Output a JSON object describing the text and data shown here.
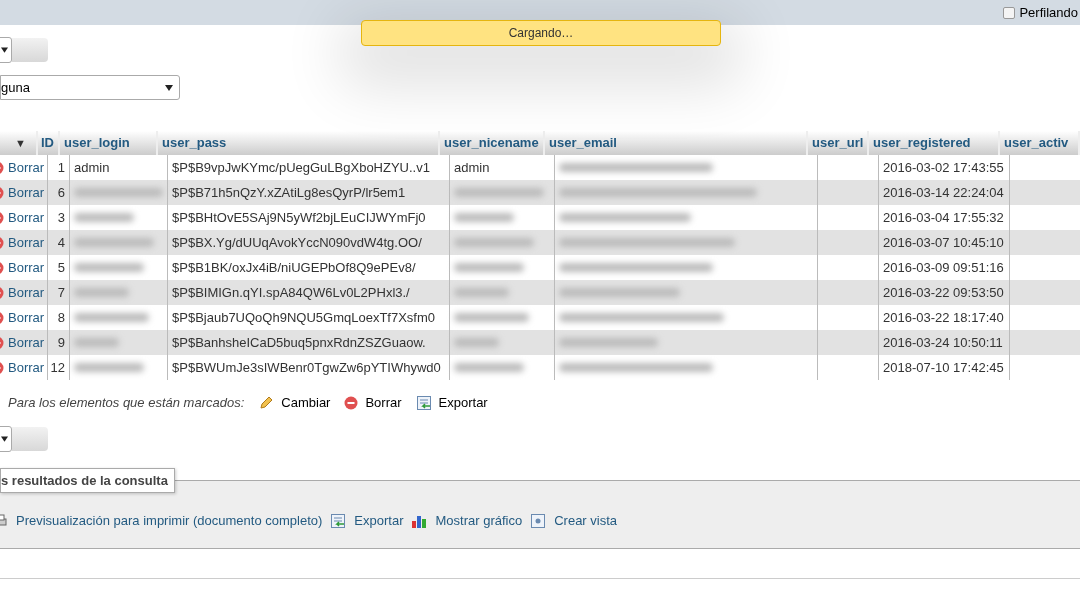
{
  "top_bar": {
    "profiling": {
      "label": "Perfilando",
      "checked": false
    }
  },
  "loading_toast": {
    "text": "Cargando…"
  },
  "filter_select": {
    "value": "guna"
  },
  "table": {
    "columns": [
      "ID",
      "user_login",
      "user_pass",
      "user_nicename",
      "user_email",
      "user_url",
      "user_registered",
      "user_activ"
    ],
    "sort_arrow": "▼",
    "rows": [
      {
        "action": "Borrar",
        "id": "1",
        "user_login": "admin",
        "user_pass": "$P$B9vpJwKYmc/pUegGuLBgXboHZYU..v1",
        "user_nicename": "admin",
        "user_registered": "2016-03-02 17:43:55"
      },
      {
        "action": "Borrar",
        "id": "6",
        "user_pass": "$P$B71h5nQzY.xZAtiLg8esQyrP/lr5em1",
        "user_registered": "2016-03-14 22:24:04"
      },
      {
        "action": "Borrar",
        "id": "3",
        "user_pass": "$P$BHtOvE5SAj9N5yWf2bjLEuCIJWYmFj0",
        "user_registered": "2016-03-04 17:55:32"
      },
      {
        "action": "Borrar",
        "id": "4",
        "user_pass": "$P$BX.Yg/dUUqAvokYccN090vdW4tg.OO/",
        "user_registered": "2016-03-07 10:45:10"
      },
      {
        "action": "Borrar",
        "id": "5",
        "user_pass": "$P$B1BK/oxJx4iB/niUGEPbOf8Q9ePEv8/",
        "user_registered": "2016-03-09 09:51:16"
      },
      {
        "action": "Borrar",
        "id": "7",
        "user_pass": "$P$BIMIGn.qYI.spA84QW6Lv0L2PHxl3./",
        "user_registered": "2016-03-22 09:53:50"
      },
      {
        "action": "Borrar",
        "id": "8",
        "user_pass": "$P$Bjaub7UQoQh9NQU5GmqLoexTf7Xsfm0",
        "user_registered": "2016-03-22 18:17:40"
      },
      {
        "action": "Borrar",
        "id": "9",
        "user_pass": "$P$BanhsheICaD5buq5pnxRdnZSZGuaow.",
        "user_registered": "2016-03-24 10:50:11"
      },
      {
        "action": "Borrar",
        "id": "12",
        "user_pass": "$P$BWUmJe3sIWBenr0TgwZw6pYTIWhywd0",
        "user_registered": "2018-07-10 17:42:45"
      }
    ]
  },
  "marked_actions": {
    "label": "Para los elementos que están marcados:",
    "items": [
      {
        "kind": "edit",
        "label": "Cambiar"
      },
      {
        "kind": "delete",
        "label": "Borrar"
      },
      {
        "kind": "export",
        "label": "Exportar"
      }
    ]
  },
  "query_results": {
    "legend": "s resultados de la consulta",
    "links": [
      {
        "kind": "print",
        "label": "Previsualización para imprimir (documento completo)"
      },
      {
        "kind": "export",
        "label": "Exportar"
      },
      {
        "kind": "chart",
        "label": "Mostrar gráfico"
      },
      {
        "kind": "view",
        "label": "Crear vista"
      }
    ]
  }
}
